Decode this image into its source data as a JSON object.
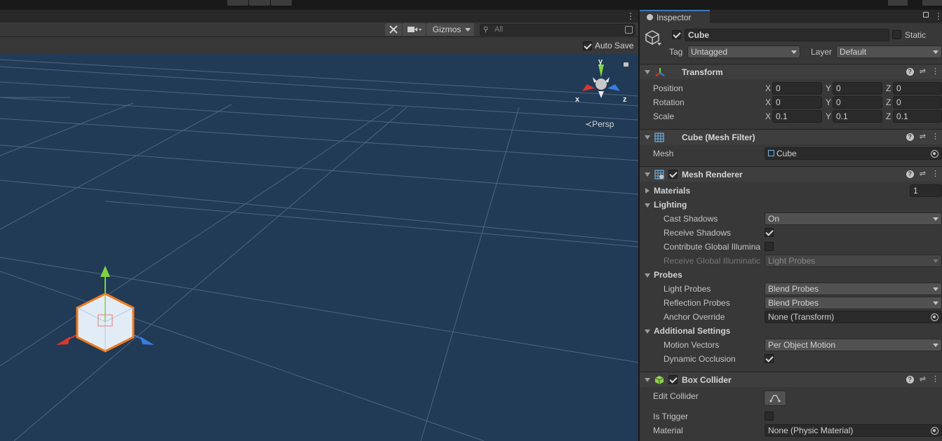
{
  "scene": {
    "toolbar": {
      "gizmos_label": "Gizmos",
      "search_placeholder": "All"
    },
    "auto_save_label": "Auto Save",
    "auto_save_checked": true,
    "orientation": {
      "x_label": "x",
      "y_label": "y",
      "z_label": "z",
      "projection_label": "Persp"
    }
  },
  "inspector": {
    "tab_label": "Inspector",
    "object": {
      "name": "Cube",
      "active": true,
      "static_label": "Static",
      "static_checked": false,
      "tag_label": "Tag",
      "tag_value": "Untagged",
      "layer_label": "Layer",
      "layer_value": "Default"
    },
    "transform": {
      "title": "Transform",
      "rows": [
        {
          "label": "Position",
          "x": "0",
          "y": "0",
          "z": "0"
        },
        {
          "label": "Rotation",
          "x": "0",
          "y": "0",
          "z": "0"
        },
        {
          "label": "Scale",
          "x": "0.1",
          "y": "0.1",
          "z": "0.1"
        }
      ],
      "axis_x": "X",
      "axis_y": "Y",
      "axis_z": "Z"
    },
    "mesh_filter": {
      "title": "Cube (Mesh Filter)",
      "mesh_label": "Mesh",
      "mesh_value": "Cube"
    },
    "mesh_renderer": {
      "title": "Mesh Renderer",
      "enabled": true,
      "materials_label": "Materials",
      "materials_count": "1",
      "lighting_label": "Lighting",
      "cast_shadows_label": "Cast Shadows",
      "cast_shadows_value": "On",
      "receive_shadows_label": "Receive Shadows",
      "receive_shadows_checked": true,
      "contribute_gi_label": "Contribute Global Illumina",
      "contribute_gi_checked": false,
      "receive_gi_label": "Receive Global Illuminatic",
      "receive_gi_value": "Light Probes",
      "probes_label": "Probes",
      "light_probes_label": "Light Probes",
      "light_probes_value": "Blend Probes",
      "reflection_probes_label": "Reflection Probes",
      "reflection_probes_value": "Blend Probes",
      "anchor_override_label": "Anchor Override",
      "anchor_override_value": "None (Transform)",
      "additional_settings_label": "Additional Settings",
      "motion_vectors_label": "Motion Vectors",
      "motion_vectors_value": "Per Object Motion",
      "dynamic_occlusion_label": "Dynamic Occlusion",
      "dynamic_occlusion_checked": true
    },
    "box_collider": {
      "title": "Box Collider",
      "enabled": true,
      "edit_collider_label": "Edit Collider",
      "is_trigger_label": "Is Trigger",
      "is_trigger_checked": false,
      "material_label": "Material",
      "material_value": "None (Physic Material)"
    }
  },
  "colors": {
    "viewport_bg": "#213a55",
    "selection_outline": "#f07a1c",
    "axis_x": "#d8372f",
    "axis_y": "#7fd43f",
    "axis_z": "#3a7be0"
  }
}
